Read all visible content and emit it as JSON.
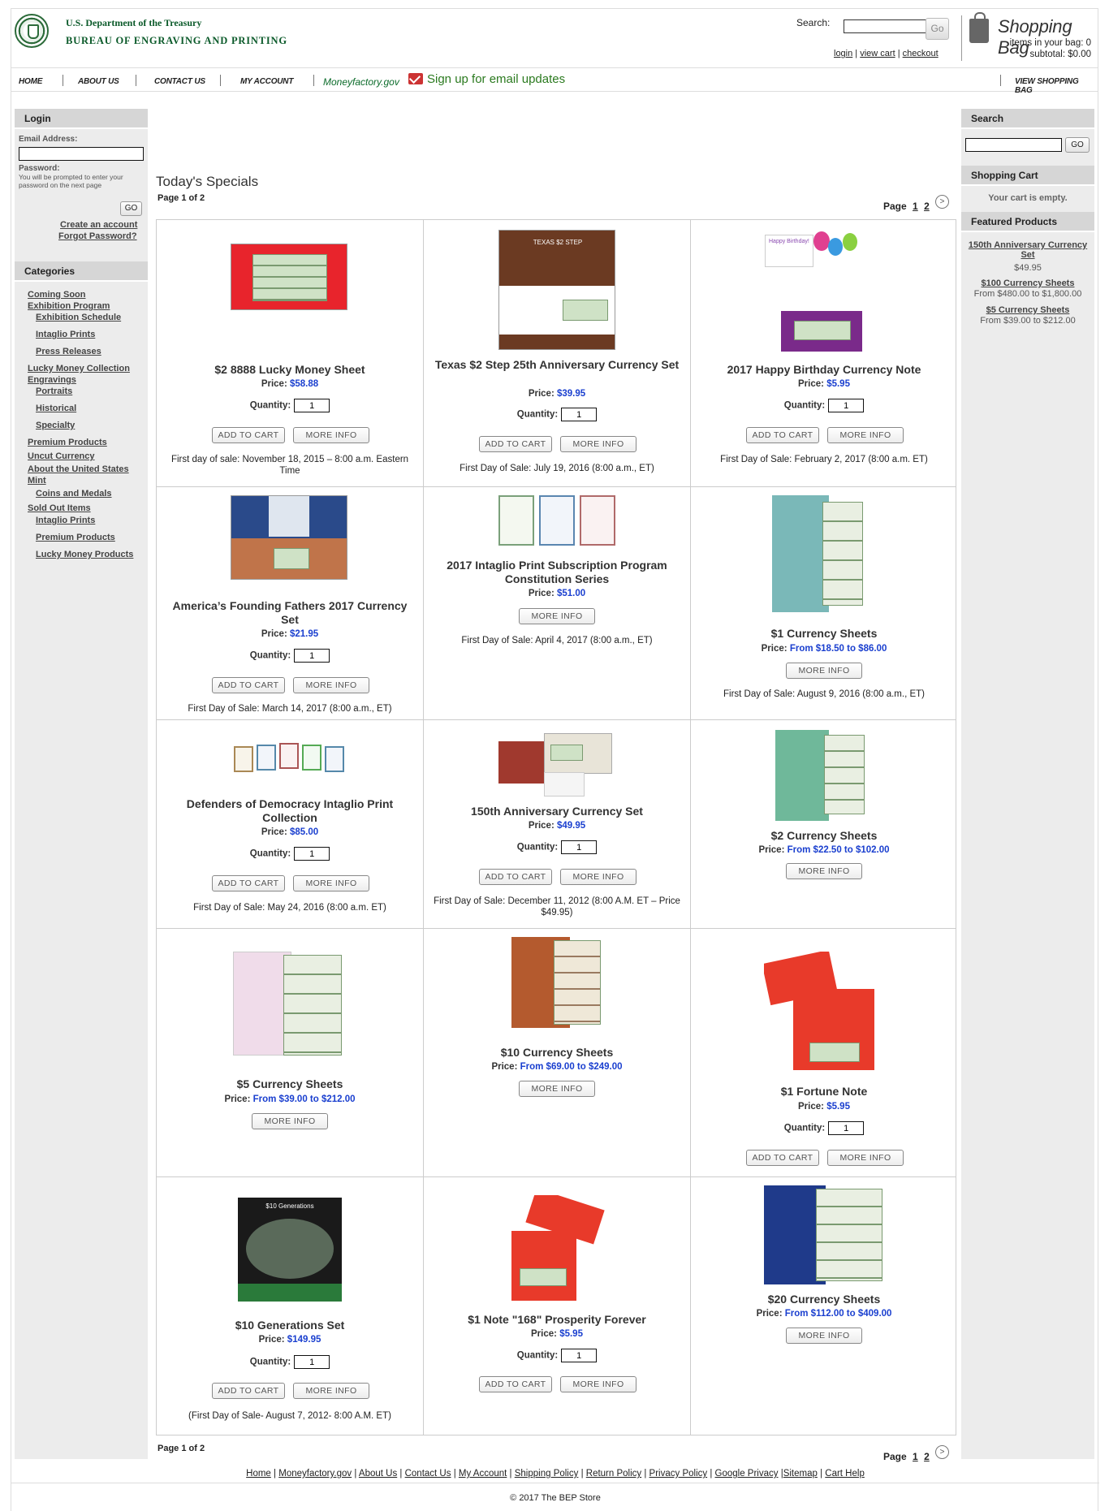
{
  "header": {
    "dept": "U.S. Department of the Treasury",
    "bureau": "BUREAU OF ENGRAVING AND PRINTING",
    "search_label": "Search:",
    "search_go": "Go",
    "login": "login",
    "view_cart": "view cart",
    "checkout": "checkout",
    "bag_title": "Shopping Bag",
    "bag_items": "items in your bag: 0",
    "bag_subtotal": "subtotal: $0.00"
  },
  "nav": {
    "home": "HOME",
    "about": "ABOUT US",
    "contact": "CONTACT US",
    "account": "MY ACCOUNT",
    "moneyfactory": "Moneyfactory.gov",
    "signup": "Sign up for email updates",
    "view_bag": "VIEW SHOPPING BAG"
  },
  "login": {
    "title": "Login",
    "email_label": "Email Address:",
    "password_label": "Password:",
    "password_note": "You will be prompted to enter your password on the next page",
    "go": "GO",
    "create": "Create an account",
    "forgot": "Forgot Password?"
  },
  "categories": {
    "title": "Categories",
    "items": [
      "Coming Soon",
      "Exhibition Program",
      "Exhibition Schedule",
      "Intaglio Prints",
      "Press Releases",
      "Lucky Money Collection",
      "Engravings",
      "Portraits",
      "Historical",
      "Specialty",
      "Premium Products",
      "Uncut Currency",
      "About the United States Mint",
      "Coins and Medals",
      "Sold Out Items",
      "Intaglio Prints",
      "Premium Products",
      "Lucky Money Products"
    ]
  },
  "right": {
    "search_title": "Search",
    "go": "GO",
    "cart_title": "Shopping Cart",
    "cart_empty": "Your cart is empty.",
    "featured_title": "Featured Products",
    "featured": [
      {
        "name": "150th Anniversary Currency Set",
        "price": "$49.95"
      },
      {
        "name": "$100 Currency Sheets",
        "price": "From $480.00 to $1,800.00"
      },
      {
        "name": "$5 Currency Sheets",
        "price": "From $39.00 to $212.00"
      }
    ]
  },
  "main": {
    "title": "Today's Specials",
    "page_info": "Page 1 of 2",
    "page_label": "Page",
    "pages": [
      "1",
      "2"
    ],
    "next": ">"
  },
  "labels": {
    "price": "Price:",
    "quantity": "Quantity:",
    "add_to_cart": "ADD TO CART",
    "more_info": "MORE INFO",
    "qty_default": "1"
  },
  "products": [
    {
      "name": "$2 8888 Lucky Money Sheet",
      "price": "$58.88",
      "sale": "First day of sale: November 18, 2015 – 8:00 a.m. Eastern Time"
    },
    {
      "name": "Texas $2 Step 25th Anniversary Currency Set",
      "price": "$39.95",
      "sale": "First Day of Sale: July 19, 2016 (8:00 a.m., ET)"
    },
    {
      "name": "2017 Happy Birthday Currency Note",
      "price": "$5.95",
      "sale": "First Day of Sale: February 2, 2017 (8:00 a.m. ET)"
    },
    {
      "name": "America’s Founding Fathers 2017 Currency Set",
      "price": "$21.95",
      "sale": "First Day of Sale: March 14, 2017 (8:00 a.m., ET)"
    },
    {
      "name": "2017 Intaglio Print Subscription Program Constitution Series",
      "price": "$51.00",
      "sale": "First Day of Sale: April 4, 2017 (8:00 a.m., ET)"
    },
    {
      "name": "$1 Currency Sheets",
      "price": "From $18.50 to $86.00",
      "sale": "First Day of Sale: August 9, 2016 (8:00 a.m., ET)"
    },
    {
      "name": "Defenders of Democracy Intaglio Print Collection",
      "price": "$85.00",
      "sale": "First Day of Sale: May 24, 2016 (8:00 a.m. ET)"
    },
    {
      "name": "150th Anniversary Currency Set",
      "price": "$49.95",
      "sale": "First Day of Sale: December 11, 2012 (8:00 A.M. ET – Price $49.95)"
    },
    {
      "name": "$2 Currency Sheets",
      "price": "From $22.50 to $102.00",
      "sale": ""
    },
    {
      "name": "$5 Currency Sheets",
      "price": "From $39.00 to $212.00",
      "sale": ""
    },
    {
      "name": "$10 Currency Sheets",
      "price": "From $69.00 to $249.00",
      "sale": ""
    },
    {
      "name": "$1 Fortune Note",
      "price": "$5.95",
      "sale": ""
    },
    {
      "name": "$10 Generations Set",
      "price": "$149.95",
      "sale": "(First Day of Sale- August 7, 2012- 8:00 A.M. ET)"
    },
    {
      "name": "$1 Note \"168\" Prosperity Forever",
      "price": "$5.95",
      "sale": ""
    },
    {
      "name": "$20 Currency Sheets",
      "price": "From $112.00 to $409.00",
      "sale": ""
    }
  ],
  "thumb_text": {
    "texas": "TEXAS $2 STEP",
    "birthday": "Happy Birthday!",
    "gen": "$10 Generations"
  },
  "footer": {
    "links": [
      "Home",
      "Moneyfactory.gov",
      "About Us",
      "Contact Us",
      "My Account",
      "Shipping Policy",
      "Return Policy",
      "Privacy Policy",
      "Google Privacy",
      "Sitemap",
      "Cart Help"
    ],
    "copyright": "© 2017 The BEP Store"
  },
  "colors": {
    "brand_green": "#0b5a2a",
    "price_blue": "#1a3fcf",
    "panel_gray": "#ececec"
  }
}
